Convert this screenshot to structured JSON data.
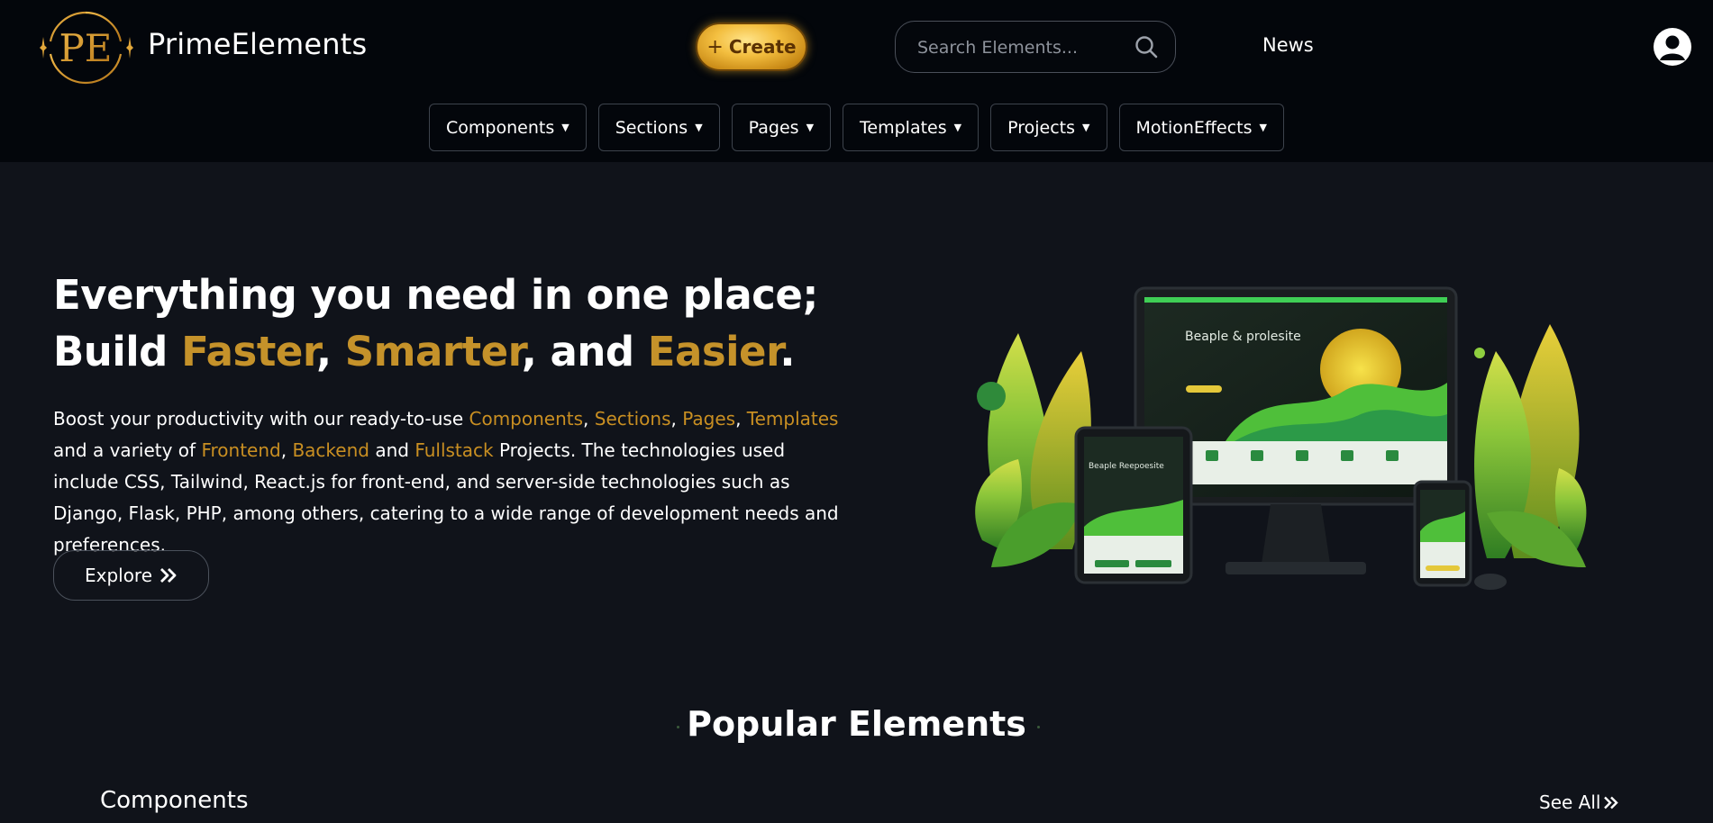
{
  "header": {
    "brand": "PrimeElements",
    "logo_text": "PE",
    "create_label": "Create",
    "search_placeholder": "Search Elements...",
    "news_label": "News"
  },
  "nav": {
    "items": [
      {
        "label": "Components"
      },
      {
        "label": "Sections"
      },
      {
        "label": "Pages"
      },
      {
        "label": "Templates"
      },
      {
        "label": "Projects"
      },
      {
        "label": "MotionEffects"
      }
    ]
  },
  "hero": {
    "line1": "Everything you need in one place;",
    "line2_build": "Build ",
    "line2_faster": "Faster",
    "line2_comma1": ", ",
    "line2_smarter": "Smarter",
    "line2_and": ", and ",
    "line2_easier": "Easier",
    "line2_period": ".",
    "desc": {
      "t1": "Boost your productivity with our ready-to-use ",
      "components": "Components",
      "c1": ", ",
      "sections": "Sections",
      "c2": ", ",
      "pages": "Pages",
      "c3": ", ",
      "templates": "Templates",
      "t2": " and a variety of ",
      "frontend": "Frontend",
      "c4": ", ",
      "backend": "Backend",
      "t3": " and ",
      "fullstack": "Fullstack",
      "t4": " Projects. The technologies used include CSS, Tailwind, React.js for front-end, and server-side technologies such as Django, Flask, PHP, among others, catering to a wide range of development needs and preferences."
    },
    "explore_label": "Explore",
    "illustration_title_desktop": "Beaple & prolesite",
    "illustration_title_tablet": "Beaple Reepoesite"
  },
  "popular": {
    "title": "Popular Elements",
    "section_label": "Components",
    "see_all_label": "See All"
  },
  "colors": {
    "accent_gold": "#c5922a",
    "background": "#10131a",
    "header_bg": "#03060b"
  }
}
